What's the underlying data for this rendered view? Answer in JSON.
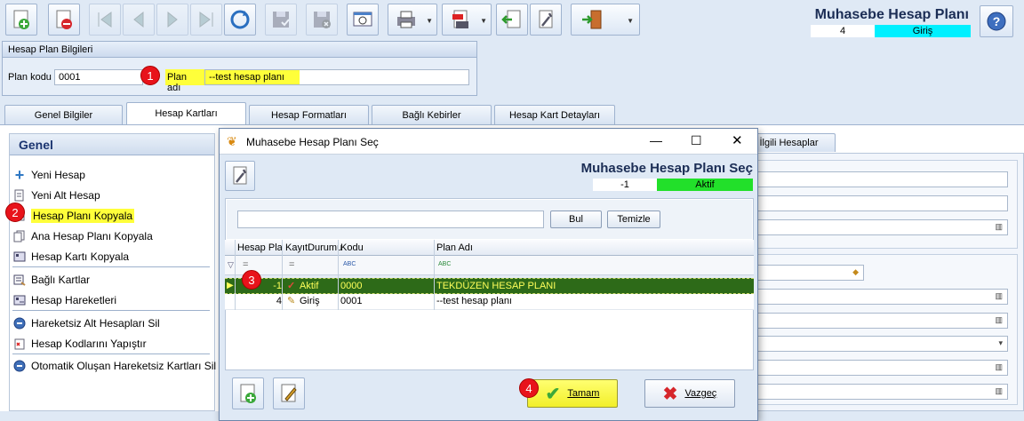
{
  "toolbar": {
    "buttons": [
      "new-doc-icon",
      "delete-doc-icon",
      "first-record-icon",
      "prev-record-icon",
      "next-record-icon",
      "last-record-icon",
      "refresh-icon",
      "save-icon",
      "save-cancel-icon",
      "preview-icon",
      "print-icon",
      "pdf-icon",
      "import-icon",
      "settings-icon",
      "exit-icon",
      "help-icon"
    ]
  },
  "header": {
    "title": "Muhasebe Hesap Planı",
    "id_value": "4",
    "status": "Giriş"
  },
  "hesap_plan_bilgileri": {
    "group_title": "Hesap Plan Bilgileri",
    "plan_kodu_label": "Plan kodu",
    "plan_kodu_value": "0001",
    "plan_adi_label": "Plan adı",
    "plan_adi_value": "--test hesap planı"
  },
  "tabs": [
    "Genel Bilgiler",
    "Hesap Kartları",
    "Hesap Formatları",
    "Bağlı Kebirler",
    "Hesap Kart Detayları"
  ],
  "right_tab": "İlgili Hesaplar",
  "sidebar": {
    "title": "Genel",
    "items": [
      {
        "label": "Yeni Hesap",
        "icon": "plus-icon"
      },
      {
        "label": "Yeni Alt Hesap",
        "icon": "sub-account-icon"
      },
      {
        "label": "Hesap Planı Kopyala",
        "icon": "copy-plan-icon"
      },
      {
        "label": "Ana Hesap Planı Kopyala",
        "icon": "copy-main-plan-icon"
      },
      {
        "label": "Hesap Kartı Kopyala",
        "icon": "copy-card-icon"
      },
      {
        "label": "Bağlı Kartlar",
        "icon": "linked-cards-icon"
      },
      {
        "label": "Hesap Hareketleri",
        "icon": "movements-icon"
      },
      {
        "label": "Hareketsiz Alt Hesapları Sil",
        "icon": "remove-icon"
      },
      {
        "label": "Hesap Kodlarını Yapıştır",
        "icon": "paste-icon"
      },
      {
        "label": "Otomatik Oluşan Hareketsiz Kartları Sil",
        "icon": "remove-icon"
      }
    ]
  },
  "badges": [
    "1",
    "2",
    "3",
    "4"
  ],
  "dialog": {
    "window_title": "Muhasebe Hesap Planı Seç",
    "title": "Muhasebe Hesap Planı Seç",
    "id_value": "-1",
    "status": "Aktif",
    "search_value": "",
    "bul_label": "Bul",
    "temizle_label": "Temizle",
    "columns": [
      "Hesap Pla",
      "KayıtDurumu",
      "Kodu",
      "Plan Adı"
    ],
    "filter_row": [
      "=",
      "=",
      "ABC",
      "ABC"
    ],
    "rows": [
      {
        "hesap": "-1",
        "durum": "Aktif",
        "kodu": "0000",
        "plan_adi": "TEKDÜZEN HESAP PLANI"
      },
      {
        "hesap": "4",
        "durum": "Giriş",
        "kodu": "0001",
        "plan_adi": "--test hesap planı"
      }
    ],
    "tamam_label": "Tamam",
    "vazgec_label": "Vazgeç"
  },
  "colors": {
    "accent_cyan": "#00f0ff",
    "accent_green": "#22e02a",
    "highlight_yellow": "#ffff3a",
    "selected_row": "#2d6a18"
  }
}
